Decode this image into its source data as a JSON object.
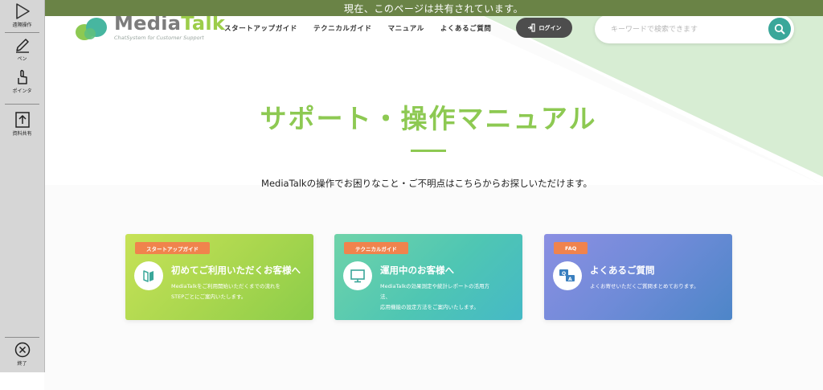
{
  "toolbar": {
    "remote_label": "遠隔操作",
    "pen_label": "ペン",
    "pointer_label": "ポインタ",
    "share_label": "資料共有",
    "exit_label": "終了"
  },
  "banner": {
    "text": "現在、このページは共有されています。"
  },
  "logo": {
    "name_part1": "Media",
    "name_part2": "Talk",
    "tagline": "ChatSystem for Customer Support"
  },
  "nav": {
    "items": [
      "スタートアップガイド",
      "テクニカルガイド",
      "マニュアル",
      "よくあるご質問"
    ],
    "login": "ログイン"
  },
  "search": {
    "placeholder": "キーワードで検索できます",
    "value": ""
  },
  "hero": {
    "title": "サポート・操作マニュアル",
    "description": "MediaTalkの操作でお困りなこと・ご不明点はこちらからお探しいただけます。"
  },
  "cards": [
    {
      "tag": "スタートアップガイド",
      "title": "初めてご利用いただくお客様へ",
      "desc_lines": [
        "MediaTalkをご利用開始いただくまでの流れを",
        "STEPごとにご案内いたします。"
      ],
      "icon": "book-icon"
    },
    {
      "tag": "テクニカルガイド",
      "title": "運用中のお客様へ",
      "desc_lines": [
        "MediaTalkの効果測定や統計レポートの活用方",
        "法、",
        "応用機能の設定方法をご案内いたします。"
      ],
      "icon": "monitor-icon"
    },
    {
      "tag": "FAQ",
      "title": "よくあるご質問",
      "desc_lines": [
        "よくお寄せいただくご質問まとめております。"
      ],
      "icon": "qa-chat-icon"
    }
  ],
  "colors": {
    "brand_green": "#8dc952",
    "banner": "#6a8346",
    "tag_orange": "#f0834d",
    "search_button": "#3aa79a",
    "diagonal_band": "#d6ecd0"
  }
}
